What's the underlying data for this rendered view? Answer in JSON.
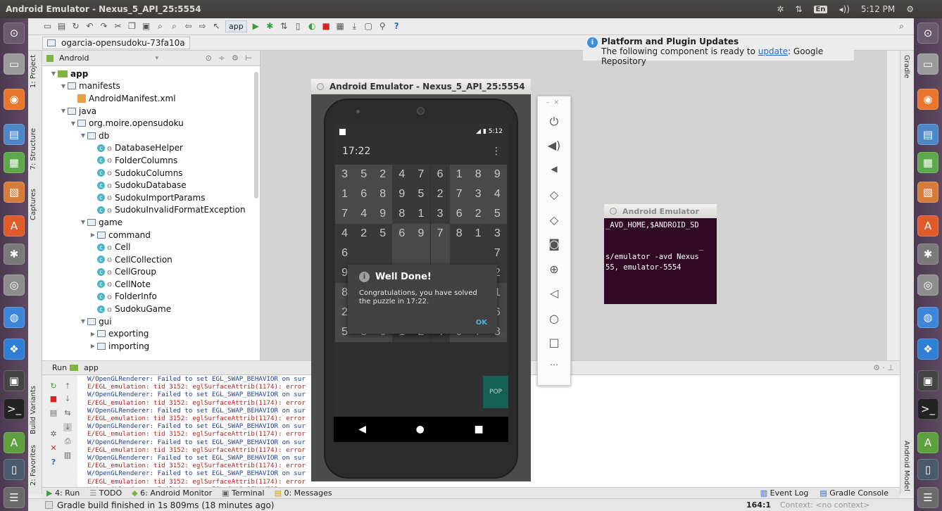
{
  "topbar": {
    "title": "Android Emulator - Nexus_5_API_25:5554",
    "lang": "En",
    "volume": "◂))",
    "time": "5:12 PM"
  },
  "toolbar": {
    "run_config": "app"
  },
  "breadcrumb": {
    "project": "ogarcia-opensudoku-73fa10a"
  },
  "left_tabs": {
    "project": "1: Project",
    "structure": "7: Structure",
    "captures": "Captures",
    "build_variants": "Build Variants",
    "favorites": "2: Favorites"
  },
  "right_tabs": {
    "gradle": "Gradle",
    "android_model": "Android Model"
  },
  "project_panel": {
    "view": "Android",
    "tree": [
      {
        "label": "app",
        "indent": 0,
        "icon": "app",
        "arrow": "▼",
        "bold": true
      },
      {
        "label": "manifests",
        "indent": 1,
        "icon": "folder",
        "arrow": "▼"
      },
      {
        "label": "AndroidManifest.xml",
        "indent": 2,
        "icon": "xml",
        "arrow": ""
      },
      {
        "label": "java",
        "indent": 1,
        "icon": "folder",
        "arrow": "▼"
      },
      {
        "label": "org.moire.opensudoku",
        "indent": 2,
        "icon": "folder",
        "arrow": "▼"
      },
      {
        "label": "db",
        "indent": 3,
        "icon": "folder",
        "arrow": "▼"
      },
      {
        "label": "DatabaseHelper",
        "indent": 4,
        "icon": "class",
        "arrow": ""
      },
      {
        "label": "FolderColumns",
        "indent": 4,
        "icon": "class",
        "arrow": ""
      },
      {
        "label": "SudokuColumns",
        "indent": 4,
        "icon": "class",
        "arrow": ""
      },
      {
        "label": "SudokuDatabase",
        "indent": 4,
        "icon": "class",
        "arrow": ""
      },
      {
        "label": "SudokuImportParams",
        "indent": 4,
        "icon": "class",
        "arrow": ""
      },
      {
        "label": "SudokuInvalidFormatException",
        "indent": 4,
        "icon": "class",
        "arrow": ""
      },
      {
        "label": "game",
        "indent": 3,
        "icon": "folder",
        "arrow": "▼"
      },
      {
        "label": "command",
        "indent": 4,
        "icon": "folder",
        "arrow": "▶"
      },
      {
        "label": "Cell",
        "indent": 4,
        "icon": "class",
        "arrow": ""
      },
      {
        "label": "CellCollection",
        "indent": 4,
        "icon": "class",
        "arrow": ""
      },
      {
        "label": "CellGroup",
        "indent": 4,
        "icon": "class",
        "arrow": ""
      },
      {
        "label": "CellNote",
        "indent": 4,
        "icon": "class",
        "arrow": ""
      },
      {
        "label": "FolderInfo",
        "indent": 4,
        "icon": "class",
        "arrow": ""
      },
      {
        "label": "SudokuGame",
        "indent": 4,
        "icon": "class",
        "arrow": ""
      },
      {
        "label": "gui",
        "indent": 3,
        "icon": "folder",
        "arrow": "▼"
      },
      {
        "label": "exporting",
        "indent": 4,
        "icon": "folder",
        "arrow": "▶"
      },
      {
        "label": "importing",
        "indent": 4,
        "icon": "folder",
        "arrow": "▶"
      }
    ]
  },
  "notification": {
    "title": "Platform and Plugin Updates",
    "text_before": "The following component is ready to ",
    "link": "update",
    "text_after": ": Google Repository"
  },
  "run_panel": {
    "title": "Run",
    "config": "app",
    "log": [
      {
        "level": "w",
        "text": "W/OpenGLRenderer: Failed to set EGL_SWAP_BEHAVIOR on sur"
      },
      {
        "level": "e",
        "text": "E/EGL_emulation: tid 3152: eglSurfaceAttrib(1174): error"
      },
      {
        "level": "w",
        "text": "W/OpenGLRenderer: Failed to set EGL_SWAP_BEHAVIOR on sur"
      },
      {
        "level": "e",
        "text": "E/EGL_emulation: tid 3152: eglSurfaceAttrib(1174): error"
      },
      {
        "level": "w",
        "text": "W/OpenGLRenderer: Failed to set EGL_SWAP_BEHAVIOR on sur"
      },
      {
        "level": "e",
        "text": "E/EGL_emulation: tid 3152: eglSurfaceAttrib(1174): error"
      },
      {
        "level": "w",
        "text": "W/OpenGLRenderer: Failed to set EGL_SWAP_BEHAVIOR on sur"
      },
      {
        "level": "e",
        "text": "E/EGL_emulation: tid 3152: eglSurfaceAttrib(1174): error"
      },
      {
        "level": "w",
        "text": "W/OpenGLRenderer: Failed to set EGL_SWAP_BEHAVIOR on sur"
      },
      {
        "level": "e",
        "text": "E/EGL_emulation: tid 3152: eglSurfaceAttrib(1174): error"
      },
      {
        "level": "w",
        "text": "W/OpenGLRenderer: Failed to set EGL_SWAP_BEHAVIOR on sur"
      },
      {
        "level": "e",
        "text": "E/EGL_emulation: tid 3152: eglSurfaceAttrib(1174): error"
      },
      {
        "level": "w",
        "text": "W/OpenGLRenderer: Failed to set EGL_SWAP_BEHAVIOR on sur"
      },
      {
        "level": "e",
        "text": "E/EGL_emulation: tid 3152: eglSurfaceAttrib(1174): error"
      },
      {
        "level": "w",
        "text": "W/OpenGLRenderer: Failed to set EGL_SWAP_BEHAVIOR on sur"
      }
    ]
  },
  "bottom_tabs": {
    "run": "4: Run",
    "todo": "TODO",
    "android_monitor": "6: Android Monitor",
    "terminal": "Terminal",
    "messages": "0: Messages",
    "event_log": "Event Log",
    "gradle_console": "Gradle Console"
  },
  "statusbar": {
    "message": "Gradle build finished in 1s 809ms (18 minutes ago)",
    "position": "164:1",
    "context": "Context: <no context>"
  },
  "emulator": {
    "window_title": "Android Emulator - Nexus_5_API_25:5554",
    "status_time": "5:12",
    "timer": "17:22",
    "grid": [
      [
        "3",
        "5",
        "2",
        "4",
        "7",
        "6",
        "1",
        "8",
        "9"
      ],
      [
        "1",
        "6",
        "8",
        "9",
        "5",
        "2",
        "7",
        "3",
        "4"
      ],
      [
        "7",
        "4",
        "9",
        "8",
        "1",
        "3",
        "6",
        "2",
        "5"
      ],
      [
        "4",
        "2",
        "5",
        "6",
        "9",
        "7",
        "8",
        "1",
        "3"
      ],
      [
        "6",
        "",
        "",
        "",
        "",
        "",
        "",
        "",
        "7"
      ],
      [
        "9",
        "",
        "",
        "",
        "",
        "",
        "",
        "",
        "2"
      ],
      [
        "8",
        "",
        "",
        "",
        "",
        "",
        "",
        "",
        "1"
      ],
      [
        "2",
        "",
        "",
        "",
        "",
        "",
        "",
        "",
        "6"
      ],
      [
        "5",
        "3",
        "6",
        "1",
        "2",
        "4",
        "9",
        "7",
        "8"
      ]
    ],
    "dialog": {
      "title": "Well Done!",
      "message": "Congratulations, you have solved the puzzle in 17:22.",
      "ok": "OK"
    },
    "pop_button": "POP"
  },
  "terminal": {
    "title": "Android Emulator",
    "lines": [
      "_AVD_HOME,$ANDROID_SD",
      "",
      "                     _",
      "s/emulator -avd Nexus",
      "55, emulator-5554"
    ]
  }
}
